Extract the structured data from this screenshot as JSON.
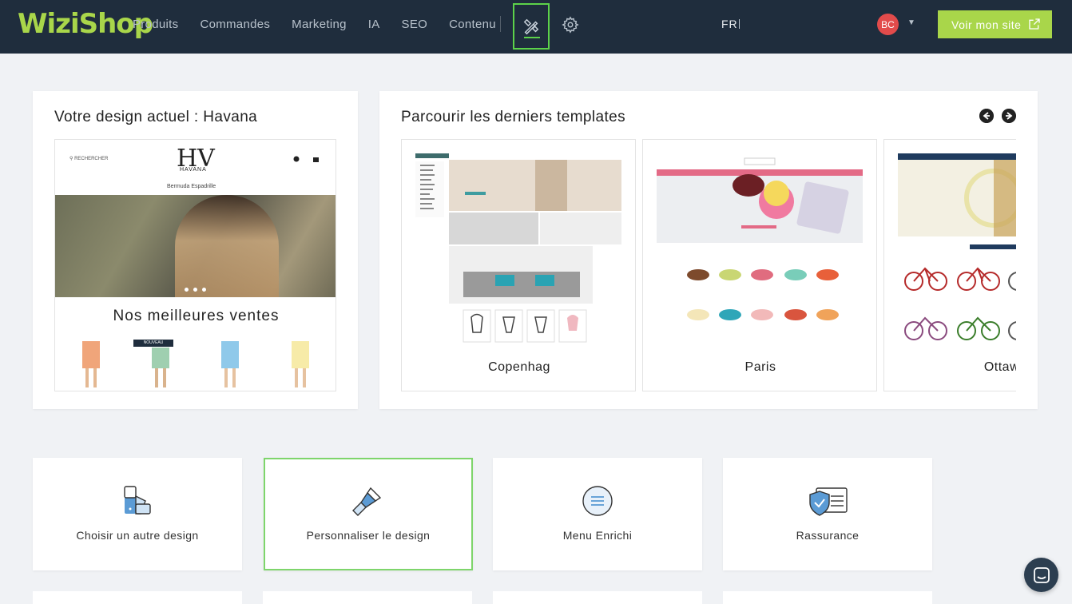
{
  "brand": {
    "logo_text": "WiziShop",
    "accent": "#a9d64a",
    "topbar_bg": "#1f2d3d",
    "active_outline": "#5cd24a"
  },
  "nav": {
    "items": [
      "Produits",
      "Commandes",
      "Marketing",
      "IA",
      "SEO",
      "Contenu"
    ]
  },
  "header": {
    "lang": "FR",
    "avatar_initials": "BC",
    "voir_site_label": "Voir mon site"
  },
  "current_design": {
    "title": "Votre design actuel : Havana",
    "preview": {
      "search": "RECHERCHER",
      "logo": "HV",
      "brand": "HAVANA",
      "links": "Bermuda   Espadrille",
      "section_title": "Nos meilleures ventes",
      "badge": "NOUVEAU"
    }
  },
  "templates": {
    "title": "Parcourir les derniers templates",
    "items": [
      {
        "name": "Copenhag"
      },
      {
        "name": "Paris"
      },
      {
        "name": "Ottaw"
      }
    ]
  },
  "actions": [
    {
      "label": "Choisir un autre design",
      "icon": "palette-swatch-icon"
    },
    {
      "label": "Personnaliser le design",
      "icon": "paint-brush-icon"
    },
    {
      "label": "Menu Enrichi",
      "icon": "menu-list-icon"
    },
    {
      "label": "Rassurance",
      "icon": "shield-check-icon"
    }
  ]
}
